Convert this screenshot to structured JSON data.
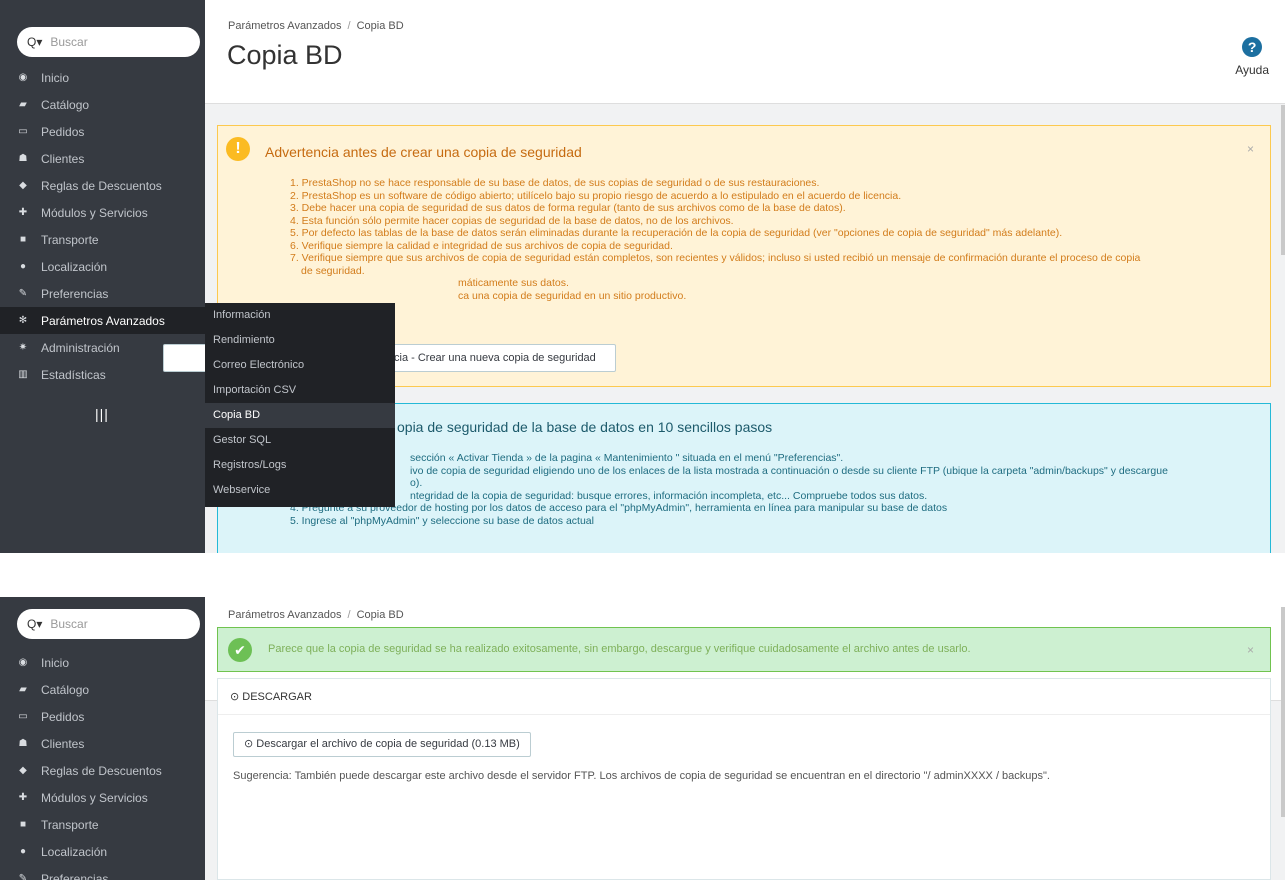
{
  "search": {
    "placeholder": "Buscar"
  },
  "nav": [
    {
      "label": "Inicio",
      "icon": "dashboard-icon"
    },
    {
      "label": "Catálogo",
      "icon": "book-icon"
    },
    {
      "label": "Pedidos",
      "icon": "credit-card-icon"
    },
    {
      "label": "Clientes",
      "icon": "users-icon"
    },
    {
      "label": "Reglas de Descuentos",
      "icon": "tag-icon"
    },
    {
      "label": "Módulos y Servicios",
      "icon": "puzzle-icon"
    },
    {
      "label": "Transporte",
      "icon": "truck-icon"
    },
    {
      "label": "Localización",
      "icon": "globe-icon"
    },
    {
      "label": "Preferencias",
      "icon": "wrench-icon"
    },
    {
      "label": "Parámetros Avanzados",
      "icon": "cogs-icon"
    },
    {
      "label": "Administración",
      "icon": "cog-icon"
    },
    {
      "label": "Estadísticas",
      "icon": "bar-chart-icon"
    }
  ],
  "header": {
    "breadcrumb_parent": "Parámetros Avanzados",
    "breadcrumb_sep": "/",
    "breadcrumb_current": "Copia BD",
    "title": "Copia BD",
    "help_label": "Ayuda"
  },
  "warning": {
    "title": "Advertencia antes de crear una copia de seguridad",
    "items": [
      "1. PrestaShop no se hace responsable de su base de datos, de sus copias de seguridad o de sus restauraciones.",
      "2. PrestaShop es un software de código abierto; utilícelo bajo su propio riesgo de acuerdo a lo estipulado en el acuerdo de licencia.",
      "3. Debe hacer una copia de seguridad de sus datos de forma regular (tanto de sus archivos como de la base de datos).",
      "4. Esta función sólo permite hacer copias de seguridad de la base de datos, no de los archivos.",
      "5. Por defecto las tablas de la base de datos serán eliminadas durante la recuperación de la copia de seguridad (ver \"opciones de copia de seguridad\" más adelante).",
      "6. Verifique siempre la calidad e integridad de sus archivos de copia de seguridad.",
      "7. Verifique siempre que sus archivos de copia de seguridad están completos, son recientes y válidos; incluso si usted recibió un mensaje de confirmación durante el proceso de copia",
      "de seguridad.",
      "máticamente sus datos.",
      "ca una copia de seguridad en un sitio productivo."
    ],
    "button": "cia - Crear una nueva copia de seguridad"
  },
  "info": {
    "title": "opia de seguridad de la base de datos en 10 sencillos pasos",
    "items": [
      "sección « Activar Tienda » de la pagina « Mantenimiento \" situada en el menú \"Preferencias\".",
      "ivo de copia de seguridad eligiendo uno de los enlaces de la lista mostrada a continuación o desde su cliente FTP (ubique la carpeta \"admin/backups\" y descargue",
      "o).",
      "ntegridad de la copia de seguridad: busque errores, información incompleta, etc... Compruebe todos sus datos.",
      "4. Pregunte a su proveedor de hosting por los datos de acceso para el \"phpMyAdmin\", herramienta en línea para manipular su base de datos",
      "5. Ingrese al \"phpMyAdmin\" y seleccione su base de datos actual"
    ]
  },
  "dropdown": [
    "Información",
    "Rendimiento",
    "Correo Electrónico",
    "Importación CSV",
    "Copia BD",
    "Gestor SQL",
    "Registros/Logs",
    "Webservice"
  ],
  "success": {
    "message": "Parece que la copia de seguridad se ha realizado exitosamente, sin embargo, descargue y verifique cuidadosamente el archivo antes de usarlo."
  },
  "download": {
    "heading": "DESCARGAR",
    "button": "Descargar el archivo de copia de seguridad (0.13 MB)",
    "tip": "Sugerencia: También puede descargar este archivo desde el servidor FTP. Los archivos de copia de seguridad se encuentran en el directorio \"/ adminXXXX / backups\"."
  },
  "colors": {
    "sidebar": "#363a41",
    "active": "#202226",
    "warning_bg": "#fff3d7",
    "info_bg": "#dcf4f9",
    "success_bg": "#cdf0d1"
  }
}
